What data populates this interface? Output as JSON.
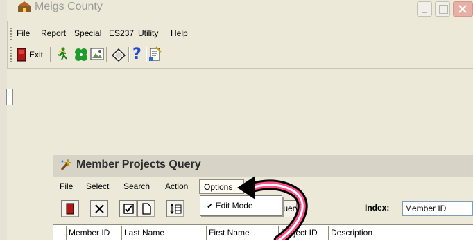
{
  "window": {
    "title": "Meigs County"
  },
  "menu": [
    {
      "label": "File",
      "u": "F"
    },
    {
      "label": "Report",
      "u": "R"
    },
    {
      "label": "Special",
      "u": "S"
    },
    {
      "label": "ES237",
      "u": "E"
    },
    {
      "label": "Utility",
      "u": "U"
    },
    {
      "label": "Help",
      "u": "H"
    }
  ],
  "toolbar": {
    "exit_label": "Exit"
  },
  "child": {
    "title": "Member Projects Query",
    "menu": [
      "File",
      "Select",
      "Search",
      "Action",
      "Options"
    ],
    "query_button": "Query",
    "index_label": "Index:",
    "index_value": "Member ID",
    "columns": [
      "Member ID",
      "Last Name",
      "First Name",
      "Project ID",
      "Description"
    ]
  },
  "dropdown": {
    "items": [
      {
        "label": "Edit Mode",
        "checked": true
      }
    ]
  },
  "colors": {
    "accent": "#e8b0a4",
    "highlight": "#ff4f8a"
  }
}
